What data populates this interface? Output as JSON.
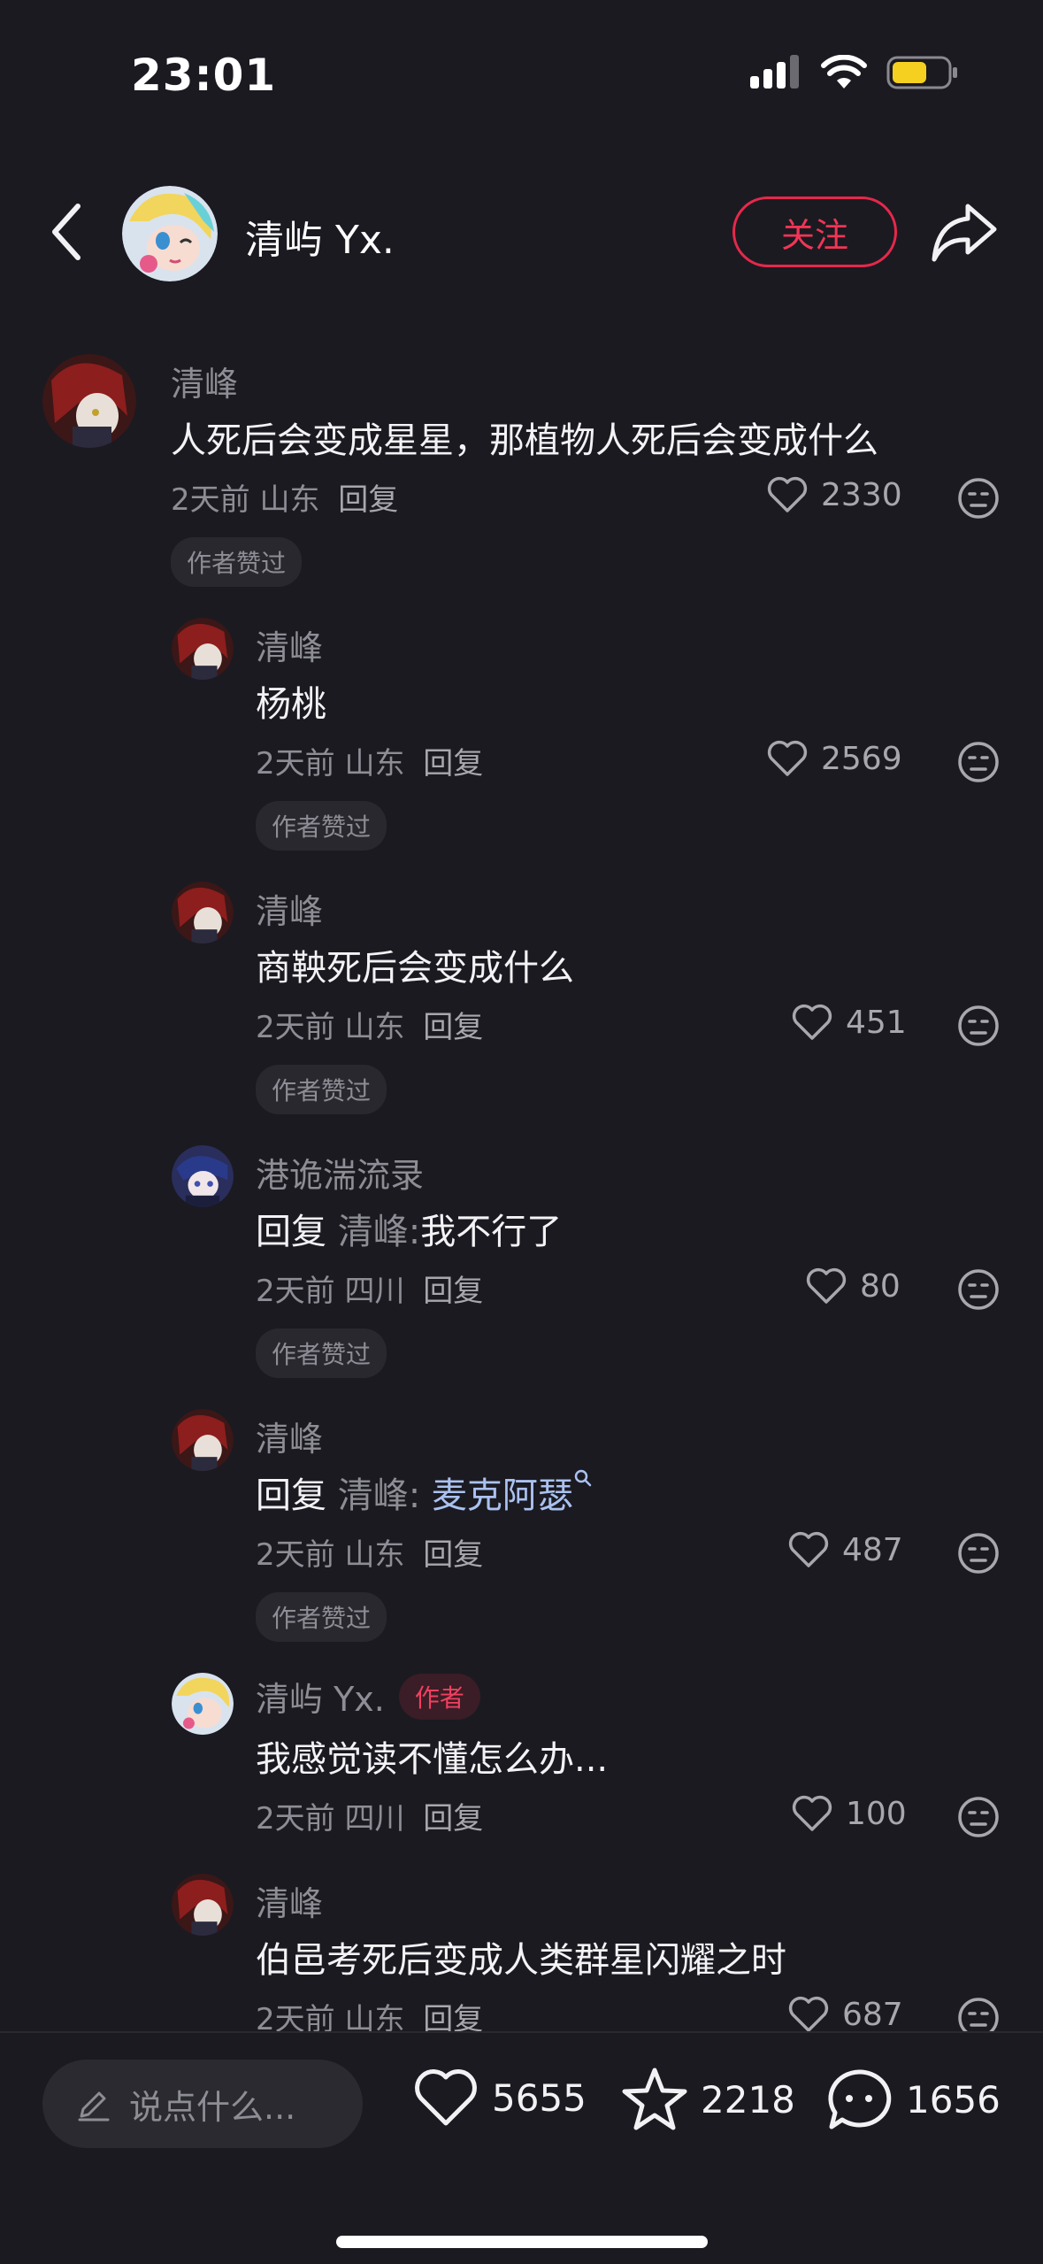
{
  "status_bar": {
    "time": "23:01"
  },
  "header": {
    "author_name": "清屿 Yx.",
    "follow_label": "关注",
    "icons": {
      "back": "chevron-left-icon",
      "share": "share-arrow-icon"
    }
  },
  "comments": [
    {
      "username": "清峰",
      "text": "人死后会变成星星，那植物人死后会变成什么",
      "time": "2天前",
      "location": "山东",
      "reply_label": "回复",
      "likes": "2330",
      "badge": "作者赞过"
    },
    {
      "username": "清峰",
      "text": "杨桃",
      "time": "2天前",
      "location": "山东",
      "reply_label": "回复",
      "likes": "2569",
      "badge": "作者赞过"
    },
    {
      "username": "清峰",
      "text": "商鞅死后会变成什么",
      "time": "2天前",
      "location": "山东",
      "reply_label": "回复",
      "likes": "451",
      "badge": "作者赞过"
    },
    {
      "username": "港诡湍流录",
      "reply_prefix": "回复",
      "reply_target": "清峰:",
      "text": "我不行了",
      "time": "2天前",
      "location": "四川",
      "reply_label": "回复",
      "likes": "80",
      "badge": "作者赞过"
    },
    {
      "username": "清峰",
      "reply_prefix": "回复",
      "reply_target": "清峰:",
      "text": "麦克阿瑟",
      "time": "2天前",
      "location": "山东",
      "reply_label": "回复",
      "likes": "487",
      "badge": "作者赞过"
    },
    {
      "username": "清屿 Yx.",
      "author_tag": "作者",
      "text": "我感觉读不懂怎么办...",
      "time": "2天前",
      "location": "四川",
      "reply_label": "回复",
      "likes": "100"
    },
    {
      "username": "清峰",
      "text": "伯邑考死后变成人类群星闪耀之时",
      "time": "2天前",
      "location": "山东",
      "reply_label": "回复",
      "likes": "687"
    }
  ],
  "bottom_bar": {
    "input_placeholder": "说点什么...",
    "likes": "5655",
    "favorites": "2218",
    "comments": "1656"
  },
  "colors": {
    "background": "#1b1a21",
    "accent_red": "#e6284b",
    "muted_text": "#8e8d95",
    "link_blue": "#aac2f0",
    "battery_yellow": "#f5d020"
  }
}
